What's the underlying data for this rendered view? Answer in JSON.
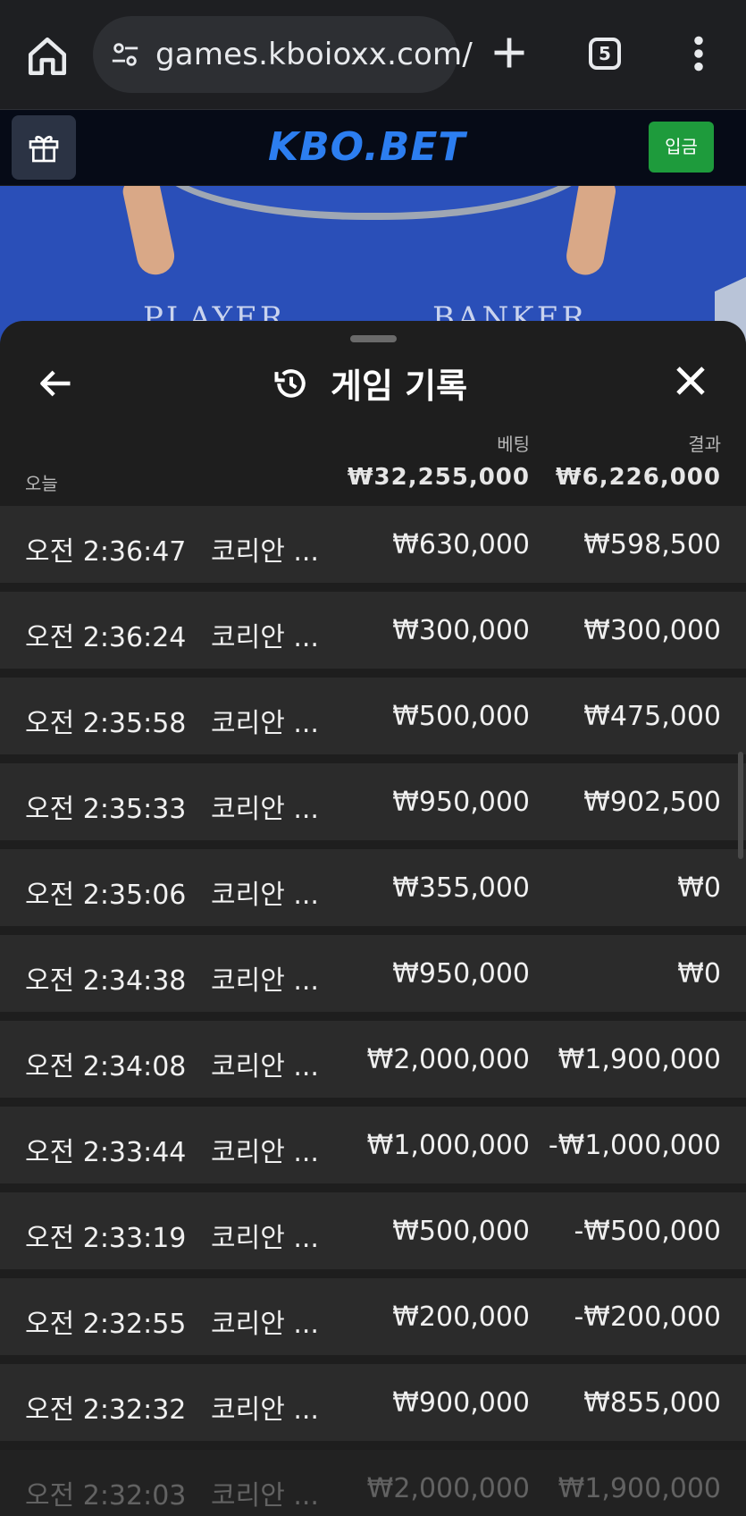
{
  "browser": {
    "url": "games.kboioxx.com/",
    "tab_count": "5"
  },
  "site": {
    "logo": "KBO.BET",
    "deposit_label": "입금"
  },
  "game_area": {
    "player_label": "PLAYER",
    "banker_label": "BANKER"
  },
  "history": {
    "title": "게임 기록",
    "bet_header": "베팅",
    "result_header": "결과",
    "period_label": "오늘",
    "total_bet": "₩32,255,000",
    "total_result": "₩6,226,000",
    "rows": [
      {
        "time": "오전 2:36:47",
        "game": "코리안 ...",
        "bet": "₩630,000",
        "result": "₩598,500"
      },
      {
        "time": "오전 2:36:24",
        "game": "코리안 ...",
        "bet": "₩300,000",
        "result": "₩300,000"
      },
      {
        "time": "오전 2:35:58",
        "game": "코리안 ...",
        "bet": "₩500,000",
        "result": "₩475,000"
      },
      {
        "time": "오전 2:35:33",
        "game": "코리안 ...",
        "bet": "₩950,000",
        "result": "₩902,500"
      },
      {
        "time": "오전 2:35:06",
        "game": "코리안 ...",
        "bet": "₩355,000",
        "result": "₩0"
      },
      {
        "time": "오전 2:34:38",
        "game": "코리안 ...",
        "bet": "₩950,000",
        "result": "₩0"
      },
      {
        "time": "오전 2:34:08",
        "game": "코리안 ...",
        "bet": "₩2,000,000",
        "result": "₩1,900,000"
      },
      {
        "time": "오전 2:33:44",
        "game": "코리안 ...",
        "bet": "₩1,000,000",
        "result": "-₩1,000,000"
      },
      {
        "time": "오전 2:33:19",
        "game": "코리안 ...",
        "bet": "₩500,000",
        "result": "-₩500,000"
      },
      {
        "time": "오전 2:32:55",
        "game": "코리안 ...",
        "bet": "₩200,000",
        "result": "-₩200,000"
      },
      {
        "time": "오전 2:32:32",
        "game": "코리안 ...",
        "bet": "₩900,000",
        "result": "₩855,000"
      },
      {
        "time": "오전 2:32:03",
        "game": "코리안 ...",
        "bet": "₩2,000,000",
        "result": "₩1,900,000"
      }
    ]
  }
}
